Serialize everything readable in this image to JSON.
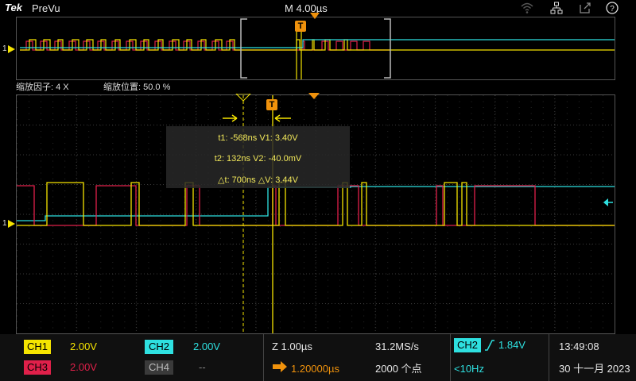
{
  "topbar": {
    "brand": "Tek",
    "app_title": "PreVu",
    "timebase": "M 4.00µs",
    "icons": [
      "wifi-icon",
      "network-icon",
      "export-icon",
      "help-icon"
    ]
  },
  "zoom": {
    "factor_label": "缩放因子: 4 X",
    "position_label": "缩放位置: 50.0 %"
  },
  "cursor_readout": {
    "line1": "t1: -568ns  V1: 3.40V",
    "line2": "t2: 132ns  V2: -40.0mV",
    "line3": "△t: 700ns  △V: 3.44V"
  },
  "markers": {
    "ground_label": "1",
    "trigger_label": "T"
  },
  "channels": {
    "ch1": {
      "label": "CH1",
      "scale": "2.00V",
      "color": "#f5e400"
    },
    "ch2": {
      "label": "CH2",
      "scale": "2.00V",
      "color": "#2ee0e0"
    },
    "ch3": {
      "label": "CH3",
      "scale": "2.00V",
      "color": "#e0204a"
    },
    "ch4": {
      "label": "CH4",
      "scale": "--",
      "color": "#8a8a8a"
    }
  },
  "horizontal": {
    "zoom": "Z 1.00µs",
    "sample_rate": "31.2MS/s",
    "delay": "1.20000µs",
    "record_length": "2000 个点"
  },
  "trigger": {
    "source": "CH2",
    "slope_icon": "rising-edge-icon",
    "level": "1.84V",
    "frequency": "<10Hz"
  },
  "clock": {
    "time": "13:49:08",
    "date": "30 十一月 2023"
  }
}
